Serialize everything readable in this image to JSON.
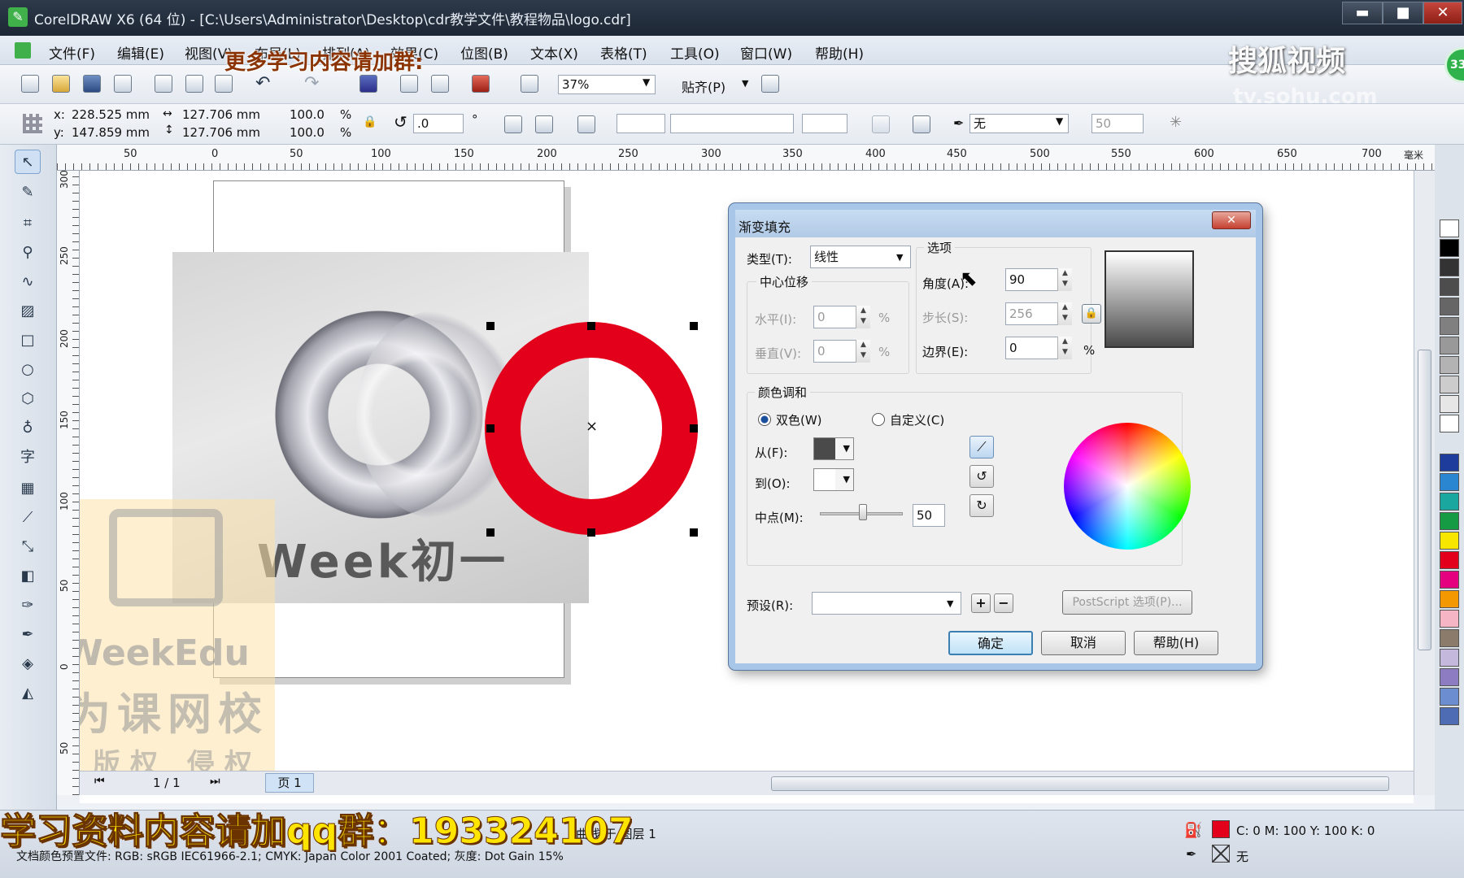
{
  "window": {
    "title": "CorelDRAW X6 (64 位) - [C:\\Users\\Administrator\\Desktop\\cdr教学文件\\教程物品\\logo.cdr]",
    "minimize": "▬",
    "maximize": "■",
    "close": "✕"
  },
  "menu": {
    "items": [
      {
        "label": "文件(F)"
      },
      {
        "label": "编辑(E)"
      },
      {
        "label": "视图(V)"
      },
      {
        "label": "布局(L)"
      },
      {
        "label": "排列(A)"
      },
      {
        "label": "效果(C)"
      },
      {
        "label": "位图(B)"
      },
      {
        "label": "文本(X)"
      },
      {
        "label": "表格(T)"
      },
      {
        "label": "工具(O)"
      },
      {
        "label": "窗口(W)"
      },
      {
        "label": "帮助(H)"
      }
    ]
  },
  "toolbar": {
    "zoom": "37%",
    "snap": "贴齐(P)"
  },
  "property_bar": {
    "x": "228.525 mm",
    "y": "147.859 mm",
    "width": "127.706 mm",
    "height": "127.706 mm",
    "scale_x": "100.0",
    "scale_y": "100.0",
    "pct": "%",
    "rotation": ".0",
    "deg": "°",
    "outline": "无",
    "outline_width": "50",
    "x_label": "x:",
    "y_label": "y:"
  },
  "ruler": {
    "h_ticks": [
      "50",
      "0",
      "50",
      "100",
      "150",
      "200",
      "250",
      "300",
      "350",
      "400",
      "450",
      "500",
      "550",
      "600",
      "650",
      "700"
    ],
    "h_unit": "毫米",
    "v_ticks": [
      "300",
      "250",
      "200",
      "150",
      "100",
      "50",
      "0",
      "50"
    ]
  },
  "canvas": {
    "logo_text": "Week初一",
    "watermark_brand": "WeekEdu",
    "watermark_cn": "为课网校",
    "watermark_copyright": "版权 侵权"
  },
  "dialog": {
    "title": "渐变填充",
    "type_label": "类型(T):",
    "type_value": "线性",
    "center_group": "中心位移",
    "horizontal_label": "水平(I):",
    "horizontal_value": "0",
    "vertical_label": "垂直(V):",
    "vertical_value": "0",
    "options_group": "选项",
    "angle_label": "角度(A):",
    "angle_value": "90",
    "steps_label": "步长(S):",
    "steps_value": "256",
    "edge_label": "边界(E):",
    "edge_value": "0",
    "pct": "%",
    "blend_group": "颜色调和",
    "two_color": "双色(W)",
    "custom": "自定义(C)",
    "from_label": "从(F):",
    "to_label": "到(O):",
    "midpoint_label": "中点(M):",
    "midpoint_value": "50",
    "preset_label": "预设(R):",
    "postscript": "PostScript 选项(P)...",
    "ok": "确定",
    "cancel": "取消",
    "help": "帮助(H)",
    "close": "✕"
  },
  "page_nav": {
    "page_count": "1 / 1",
    "page_tab": "页 1"
  },
  "status": {
    "object_info": "曲线 于 图层 1",
    "fill_info": "C: 0 M: 100 Y: 100 K: 0",
    "outline_info": "无",
    "color_profile": "文档颜色预置文件: RGB: sRGB IEC61966-2.1; CMYK: Japan Color 2001 Coated; 灰度: Dot Gain 15%"
  },
  "overlays": {
    "top_promo": "更多学习内容请加群:",
    "bottom_promo": "学习资料内容请加qq群：193324107",
    "sohu_logo": "搜狐视频",
    "sohu_url": "tv.sohu.com",
    "badge": "33"
  },
  "colors": {
    "ring_red": "#e3001b",
    "fill_swatch": "#e3001b",
    "from_color": "#4a4a4a",
    "to_color": "#ffffff"
  }
}
